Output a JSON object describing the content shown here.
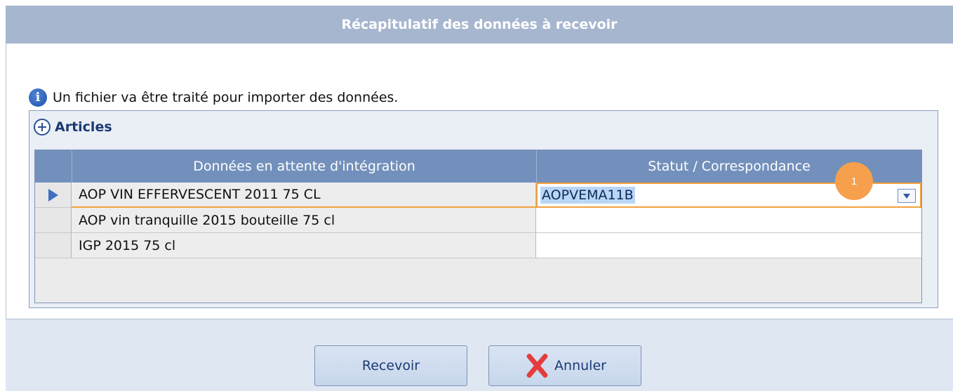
{
  "window": {
    "title": "Récapitulatif des données à recevoir"
  },
  "info": {
    "icon": "info-icon",
    "message": "Un fichier va être traité pour importer des données."
  },
  "group": {
    "icon": "collapse-icon",
    "title": "Articles"
  },
  "grid": {
    "columns": [
      "Données en attente d'intégration",
      "Statut / Correspondance"
    ],
    "rows": [
      {
        "name": "AOP VIN EFFERVESCENT 2011 75 CL",
        "status": "AOPVEMA11B",
        "active": true
      },
      {
        "name": "AOP vin tranquille 2015 bouteille 75 cl",
        "status": "",
        "active": false
      },
      {
        "name": "IGP 2015 75 cl",
        "status": "",
        "active": false
      }
    ]
  },
  "annotation": {
    "badge": "1",
    "color": "#f6a04d"
  },
  "buttons": {
    "receive": "Recevoir",
    "cancel": "Annuler",
    "cancel_icon": "close-red-x-icon"
  },
  "colors": {
    "titlebar": "#a7b6cf",
    "grid_header": "#7290bb",
    "highlight_border": "#f2a13c",
    "selection": "#b9d6f6"
  }
}
